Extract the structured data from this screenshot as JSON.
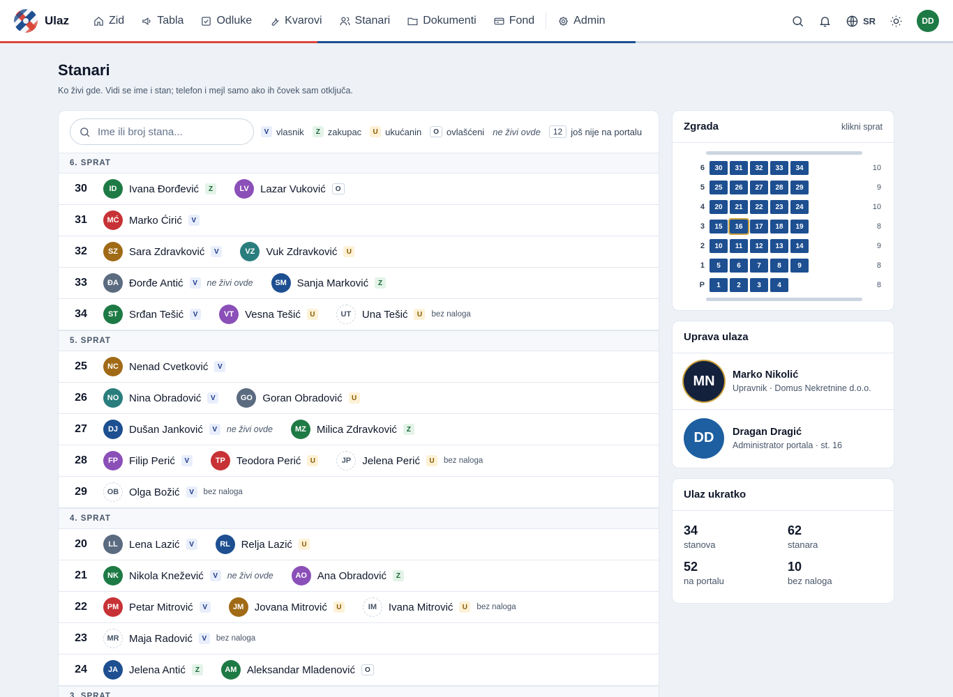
{
  "app": {
    "name": "Ulaz"
  },
  "nav": [
    {
      "id": "zid",
      "label": "Zid",
      "icon": "home-icon"
    },
    {
      "id": "tabla",
      "label": "Tabla",
      "icon": "megaphone-icon"
    },
    {
      "id": "odluke",
      "label": "Odluke",
      "icon": "checkbox-icon"
    },
    {
      "id": "kvarovi",
      "label": "Kvarovi",
      "icon": "wrench-icon"
    },
    {
      "id": "stanari",
      "label": "Stanari",
      "icon": "users-icon"
    },
    {
      "id": "dokumenti",
      "label": "Dokumenti",
      "icon": "folder-icon"
    },
    {
      "id": "fond",
      "label": "Fond",
      "icon": "card-icon"
    },
    {
      "id": "admin",
      "label": "Admin",
      "icon": "gear-icon"
    }
  ],
  "tools": {
    "language": "SR",
    "user_initials": "DD"
  },
  "colors": {
    "accent_red": "#d9483b",
    "accent_blue": "#1d4f91",
    "accent_gray": "#cbd5e1"
  },
  "page": {
    "title": "Stanari",
    "subtitle": "Ko živi gde. Vidi se ime i stan; telefon i mejl samo ako ih čovek sam otključa."
  },
  "search": {
    "placeholder": "Ime ili broj stana..."
  },
  "legend": {
    "vlasnik": "vlasnik",
    "zakupac": "zakupac",
    "ukucanin": "ukućanin",
    "ovlasceni": "ovlašćeni",
    "not_living": "ne živi ovde",
    "not_on_portal_count": "12",
    "not_on_portal_label": "još nije na portalu"
  },
  "tags": {
    "V": "V",
    "Z": "Z",
    "U": "U",
    "O": "O"
  },
  "floors": [
    {
      "label": "6. SPRAT",
      "apartments": [
        {
          "number": "30",
          "residents": [
            {
              "initials": "ID",
              "name": "Ivana Đorđević",
              "role": "Z",
              "color": "#1e7a45"
            },
            {
              "initials": "LV",
              "name": "Lazar Vuković",
              "role": "O",
              "color": "#8b4fb8"
            }
          ]
        },
        {
          "number": "31",
          "residents": [
            {
              "initials": "MĆ",
              "name": "Marko Ćirić",
              "role": "V",
              "color": "#c73236"
            }
          ]
        },
        {
          "number": "32",
          "residents": [
            {
              "initials": "SZ",
              "name": "Sara Zdravković",
              "role": "V",
              "color": "#a06a16"
            },
            {
              "initials": "VZ",
              "name": "Vuk Zdravković",
              "role": "U",
              "color": "#2a7d7d"
            }
          ]
        },
        {
          "number": "33",
          "residents": [
            {
              "initials": "ĐA",
              "name": "Đorđe Antić",
              "role": "V",
              "color": "#5b6b80",
              "note": "ne živi ovde"
            },
            {
              "initials": "SM",
              "name": "Sanja Marković",
              "role": "Z",
              "color": "#1d4f91"
            }
          ]
        },
        {
          "number": "34",
          "residents": [
            {
              "initials": "ST",
              "name": "Srđan Tešić",
              "role": "V",
              "color": "#1e7a45"
            },
            {
              "initials": "VT",
              "name": "Vesna Tešić",
              "role": "U",
              "color": "#8b4fb8"
            },
            {
              "initials": "UT",
              "name": "Una Tešić",
              "role": "U",
              "hollow": true,
              "badge": "bez naloga"
            }
          ]
        }
      ]
    },
    {
      "label": "5. SPRAT",
      "apartments": [
        {
          "number": "25",
          "residents": [
            {
              "initials": "NC",
              "name": "Nenad Cvetković",
              "role": "V",
              "color": "#a06a16"
            }
          ]
        },
        {
          "number": "26",
          "residents": [
            {
              "initials": "NO",
              "name": "Nina Obradović",
              "role": "V",
              "color": "#2a7d7d"
            },
            {
              "initials": "GO",
              "name": "Goran Obradović",
              "role": "U",
              "color": "#5b6b80"
            }
          ]
        },
        {
          "number": "27",
          "residents": [
            {
              "initials": "DJ",
              "name": "Dušan Janković",
              "role": "V",
              "color": "#1d4f91",
              "note": "ne živi ovde"
            },
            {
              "initials": "MZ",
              "name": "Milica Zdravković",
              "role": "Z",
              "color": "#1e7a45"
            }
          ]
        },
        {
          "number": "28",
          "residents": [
            {
              "initials": "FP",
              "name": "Filip Perić",
              "role": "V",
              "color": "#8b4fb8"
            },
            {
              "initials": "TP",
              "name": "Teodora Perić",
              "role": "U",
              "color": "#c73236"
            },
            {
              "initials": "JP",
              "name": "Jelena Perić",
              "role": "U",
              "hollow": true,
              "badge": "bez naloga"
            }
          ]
        },
        {
          "number": "29",
          "residents": [
            {
              "initials": "OB",
              "name": "Olga Božić",
              "role": "V",
              "hollow": true,
              "badge": "bez naloga"
            }
          ]
        }
      ]
    },
    {
      "label": "4. SPRAT",
      "apartments": [
        {
          "number": "20",
          "residents": [
            {
              "initials": "LL",
              "name": "Lena Lazić",
              "role": "V",
              "color": "#5b6b80"
            },
            {
              "initials": "RL",
              "name": "Relja Lazić",
              "role": "U",
              "color": "#1d4f91"
            }
          ]
        },
        {
          "number": "21",
          "residents": [
            {
              "initials": "NK",
              "name": "Nikola Knežević",
              "role": "V",
              "color": "#1e7a45",
              "note": "ne živi ovde"
            },
            {
              "initials": "AO",
              "name": "Ana Obradović",
              "role": "Z",
              "color": "#8b4fb8"
            }
          ]
        },
        {
          "number": "22",
          "residents": [
            {
              "initials": "PM",
              "name": "Petar Mitrović",
              "role": "V",
              "color": "#c73236"
            },
            {
              "initials": "JM",
              "name": "Jovana Mitrović",
              "role": "U",
              "color": "#a06a16"
            },
            {
              "initials": "IM",
              "name": "Ivana Mitrović",
              "role": "U",
              "hollow": true,
              "badge": "bez naloga"
            }
          ]
        },
        {
          "number": "23",
          "residents": [
            {
              "initials": "MR",
              "name": "Maja Radović",
              "role": "V",
              "hollow": true,
              "badge": "bez naloga"
            }
          ]
        },
        {
          "number": "24",
          "residents": [
            {
              "initials": "JA",
              "name": "Jelena Antić",
              "role": "Z",
              "color": "#1d4f91"
            },
            {
              "initials": "AM",
              "name": "Aleksandar Mladenović",
              "role": "O",
              "color": "#1e7a45"
            }
          ]
        }
      ]
    },
    {
      "label": "3. SPRAT",
      "apartments": []
    }
  ],
  "building": {
    "title": "Zgrada",
    "hint": "klikni sprat",
    "current_apartment": "16",
    "floors": [
      {
        "label": "6",
        "units": [
          "30",
          "31",
          "32",
          "33",
          "34"
        ],
        "count": "10"
      },
      {
        "label": "5",
        "units": [
          "25",
          "26",
          "27",
          "28",
          "29"
        ],
        "count": "9"
      },
      {
        "label": "4",
        "units": [
          "20",
          "21",
          "22",
          "23",
          "24"
        ],
        "count": "10"
      },
      {
        "label": "3",
        "units": [
          "15",
          "16",
          "17",
          "18",
          "19"
        ],
        "count": "8"
      },
      {
        "label": "2",
        "units": [
          "10",
          "11",
          "12",
          "13",
          "14"
        ],
        "count": "9"
      },
      {
        "label": "1",
        "units": [
          "5",
          "6",
          "7",
          "8",
          "9"
        ],
        "count": "8"
      },
      {
        "label": "P",
        "units": [
          "1",
          "2",
          "3",
          "4"
        ],
        "count": "8"
      }
    ]
  },
  "management": {
    "title": "Uprava ulaza",
    "people": [
      {
        "initials": "MN",
        "name": "Marko Nikolić",
        "role": "Upravnik · Domus Nekretnine d.o.o.",
        "color": "#14213d",
        "ring": "#c9a03a"
      },
      {
        "initials": "DD",
        "name": "Dragan Dragić",
        "role": "Administrator portala · st. 16",
        "color": "#1d5fa0"
      }
    ]
  },
  "summary": {
    "title": "Ulaz ukratko",
    "stats": [
      {
        "value": "34",
        "label": "stanova"
      },
      {
        "value": "62",
        "label": "stanara"
      },
      {
        "value": "52",
        "label": "na portalu"
      },
      {
        "value": "10",
        "label": "bez naloga"
      }
    ]
  }
}
